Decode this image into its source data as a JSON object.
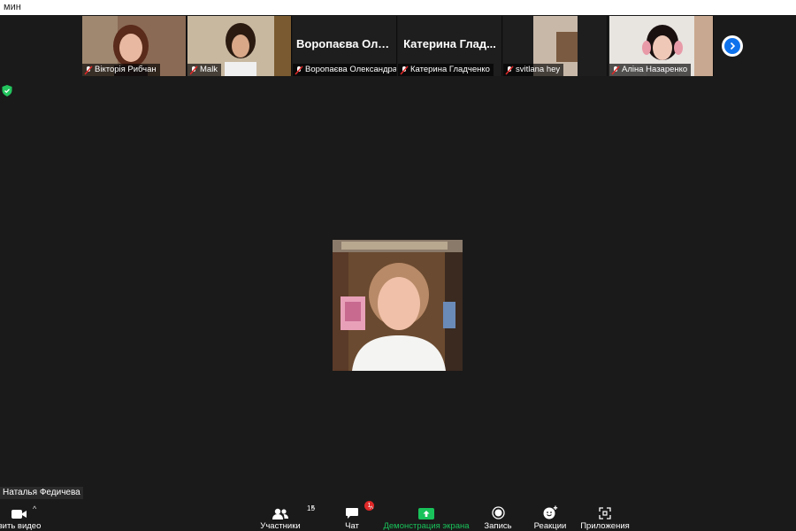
{
  "window": {
    "title": "мин"
  },
  "participants_strip": [
    {
      "name": "Вікторія Рибчан",
      "video": true
    },
    {
      "name": "Malk",
      "video": true
    },
    {
      "name": "Воропаєва Олександра",
      "display_name": "Воропаєва Оле...",
      "video": false
    },
    {
      "name": "Катерина Гладченко",
      "display_name": "Катерина Глад...",
      "video": false
    },
    {
      "name": "svitlana hey",
      "video": true
    },
    {
      "name": "Аліна Назаренко",
      "video": true
    }
  ],
  "active_speaker": {
    "name": "Наталья Федичева"
  },
  "toolbar": {
    "video_label": "вить видео",
    "participants_label": "Участники",
    "participants_count": "15",
    "chat_label": "Чат",
    "chat_badge": "1",
    "share_label": "Демонстрация экрана",
    "record_label": "Запись",
    "reactions_label": "Реакции",
    "apps_label": "Приложения"
  },
  "colors": {
    "background": "#1a1a1a",
    "share_green": "#19c25a",
    "accent_blue": "#0e72ed",
    "mute_red": "#e02828"
  }
}
